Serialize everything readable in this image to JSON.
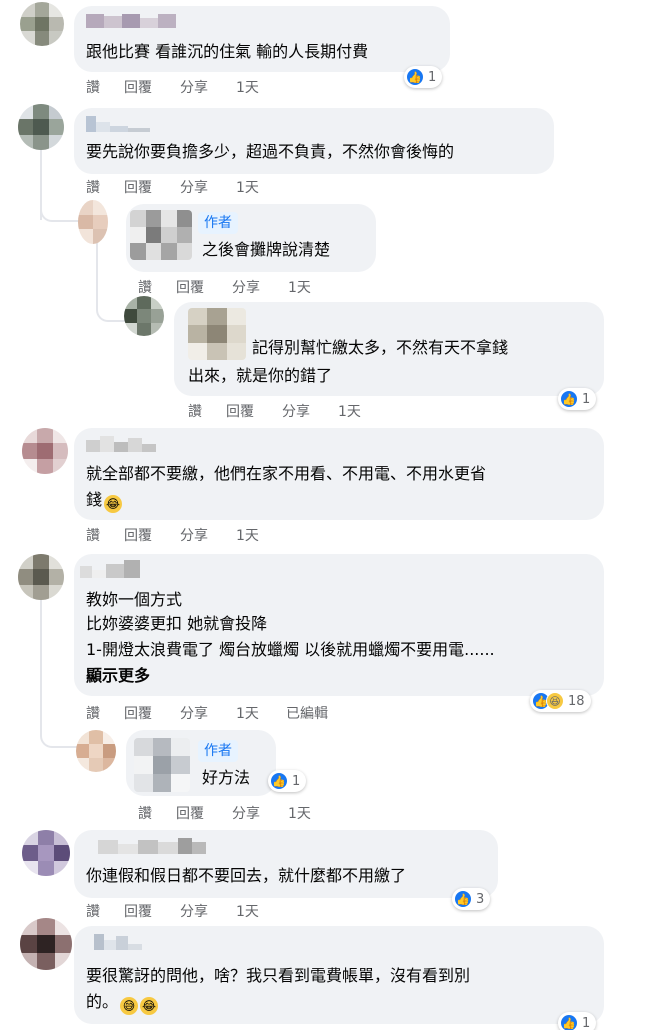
{
  "comments": [
    {
      "text_lines": [
        "跟他比賽 看誰沉的住氣 輸的人長期付費"
      ],
      "actions": [
        "讚",
        "回覆",
        "分享",
        "1天"
      ],
      "reactions": {
        "types": [
          "like"
        ],
        "count": "1"
      }
    },
    {
      "text_lines": [
        "要先說你要負擔多少，超過不負責，不然你會後悔的"
      ],
      "actions": [
        "讚",
        "回覆",
        "分享",
        "1天"
      ],
      "replies": [
        {
          "badge": "作者",
          "text_lines": [
            "之後會攤牌說清楚"
          ],
          "actions": [
            "讚",
            "回覆",
            "分享",
            "1天"
          ]
        },
        {
          "text_lines": [
            "記得別幫忙繳太多，不然有天不拿錢",
            "出來，就是你的錯了"
          ],
          "actions": [
            "讚",
            "回覆",
            "分享",
            "1天"
          ],
          "reactions": {
            "types": [
              "like"
            ],
            "count": "1"
          }
        }
      ]
    },
    {
      "text_lines": [
        "就全部都不要繳，他們在家不用看、不用電、不用水更省",
        "錢"
      ],
      "actions": [
        "讚",
        "回覆",
        "分享",
        "1天"
      ]
    },
    {
      "text_lines": [
        "教妳一個方式",
        "比妳婆婆更扣 她就會投降",
        "1-開燈太浪費電了 燭台放蠟燭 以後就用蠟燭不要用電......"
      ],
      "see_more": "顯示更多",
      "actions": [
        "讚",
        "回覆",
        "分享",
        "1天",
        "已編輯"
      ],
      "reactions": {
        "types": [
          "like",
          "haha"
        ],
        "count": "18"
      },
      "replies": [
        {
          "badge": "作者",
          "text_lines": [
            "好方法"
          ],
          "actions": [
            "讚",
            "回覆",
            "分享",
            "1天"
          ],
          "reactions": {
            "types": [
              "like"
            ],
            "count": "1"
          }
        }
      ]
    },
    {
      "text_lines": [
        "你連假和假日都不要回去，就什麼都不用繳了"
      ],
      "actions": [
        "讚",
        "回覆",
        "分享",
        "1天"
      ],
      "reactions": {
        "types": [
          "like"
        ],
        "count": "3"
      }
    },
    {
      "text_lines": [
        "要很驚訝的問他，啥？我只看到電費帳單，沒有看到別",
        "的。"
      ],
      "reactions": {
        "types": [
          "like"
        ],
        "count": "1"
      }
    }
  ],
  "colors": {
    "bubble": "#f0f2f5",
    "meta_text": "#65676b",
    "like_blue": "#1877f2",
    "haha_yellow": "#f7c942",
    "author_badge_bg": "#e7f3ff"
  },
  "icons": [
    "like-icon",
    "haha-icon",
    "grin-emoji"
  ]
}
